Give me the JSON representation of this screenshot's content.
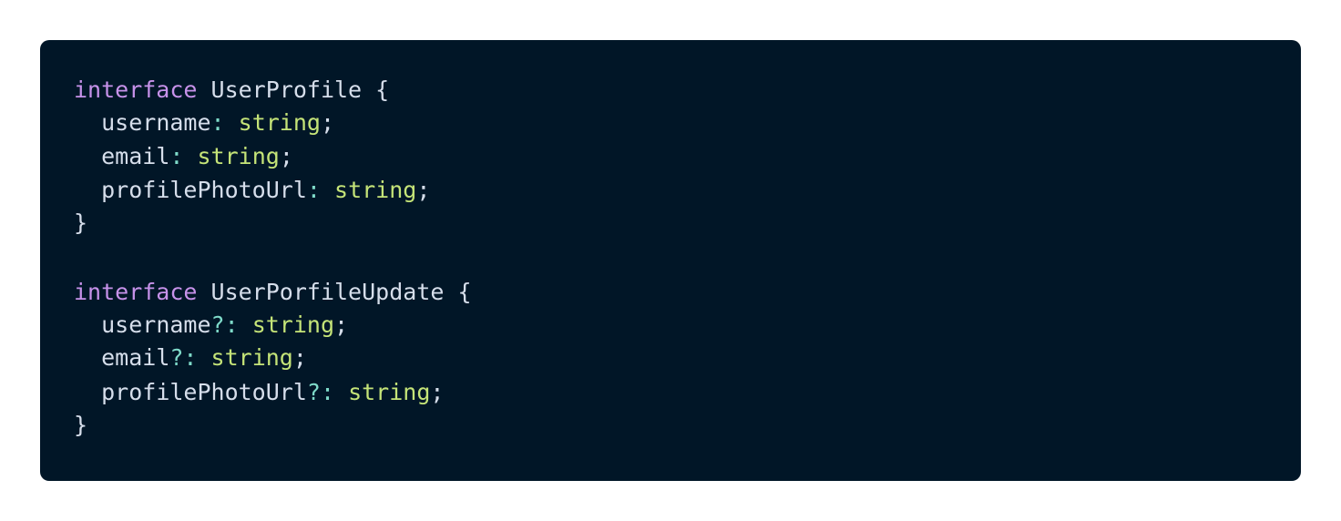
{
  "code_block": {
    "language": "typescript",
    "theme_colors": {
      "background": "#011627",
      "keyword": "#c792ea",
      "identifier": "#d6deeb",
      "punctuation": "#7fdbca",
      "type": "#c5e478"
    },
    "interfaces": [
      {
        "keyword": "interface",
        "name": "UserProfile",
        "open_brace": "{",
        "close_brace": "}",
        "fields": [
          {
            "name": "username",
            "sep": ":",
            "type": "string",
            "end": ";"
          },
          {
            "name": "email",
            "sep": ":",
            "type": "string",
            "end": ";"
          },
          {
            "name": "profilePhotoUrl",
            "sep": ":",
            "type": "string",
            "end": ";"
          }
        ]
      },
      {
        "keyword": "interface",
        "name": "UserPorfileUpdate",
        "open_brace": "{",
        "close_brace": "}",
        "fields": [
          {
            "name": "username",
            "sep": "?:",
            "type": "string",
            "end": ";"
          },
          {
            "name": "email",
            "sep": "?:",
            "type": "string",
            "end": ";"
          },
          {
            "name": "profilePhotoUrl",
            "sep": "?:",
            "type": "string",
            "end": ";"
          }
        ]
      }
    ]
  }
}
